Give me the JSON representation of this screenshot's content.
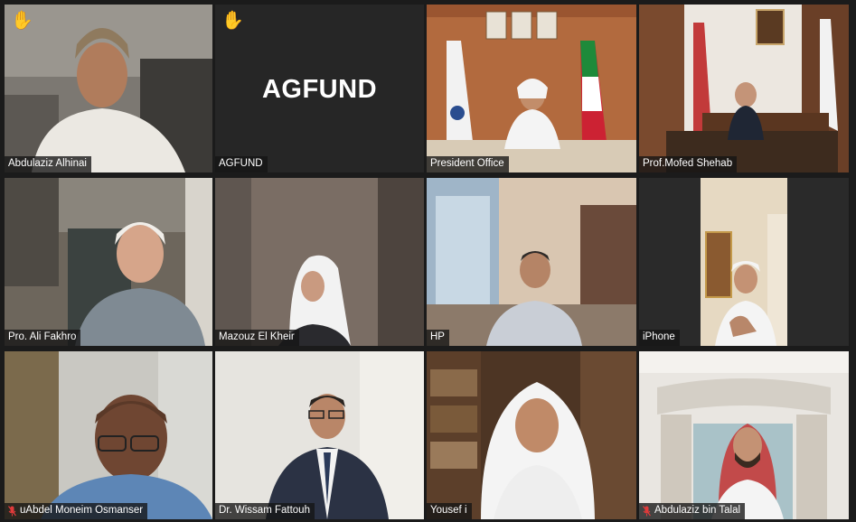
{
  "hand_glyph": "✋",
  "agfund_label": "AGFUND",
  "participants": [
    {
      "name": "Abdulaziz Alhinai",
      "hand": true,
      "muted": false
    },
    {
      "name": "AGFUND",
      "hand": true,
      "muted": false
    },
    {
      "name": "President Office",
      "hand": false,
      "muted": false
    },
    {
      "name": "Prof.Mofed Shehab",
      "hand": false,
      "muted": false
    },
    {
      "name": "Pro. Ali Fakhro",
      "hand": false,
      "muted": false
    },
    {
      "name": "Mazouz El Kheir",
      "hand": false,
      "muted": false
    },
    {
      "name": "HP",
      "hand": false,
      "muted": false
    },
    {
      "name": "iPhone",
      "hand": false,
      "muted": false
    },
    {
      "name": "uAbdel Moneim Osmanser",
      "hand": false,
      "muted": true
    },
    {
      "name": "Dr. Wissam Fattouh",
      "hand": false,
      "muted": false
    },
    {
      "name": "Yousef i",
      "hand": false,
      "muted": false
    },
    {
      "name": "Abdulaziz bin Talal",
      "hand": false,
      "muted": true
    }
  ],
  "colors": {
    "active_speaker_border": "#b6e34a",
    "hand": "#f5b400",
    "mic_muted": "#e03b3b",
    "label_bg": "#141414"
  }
}
